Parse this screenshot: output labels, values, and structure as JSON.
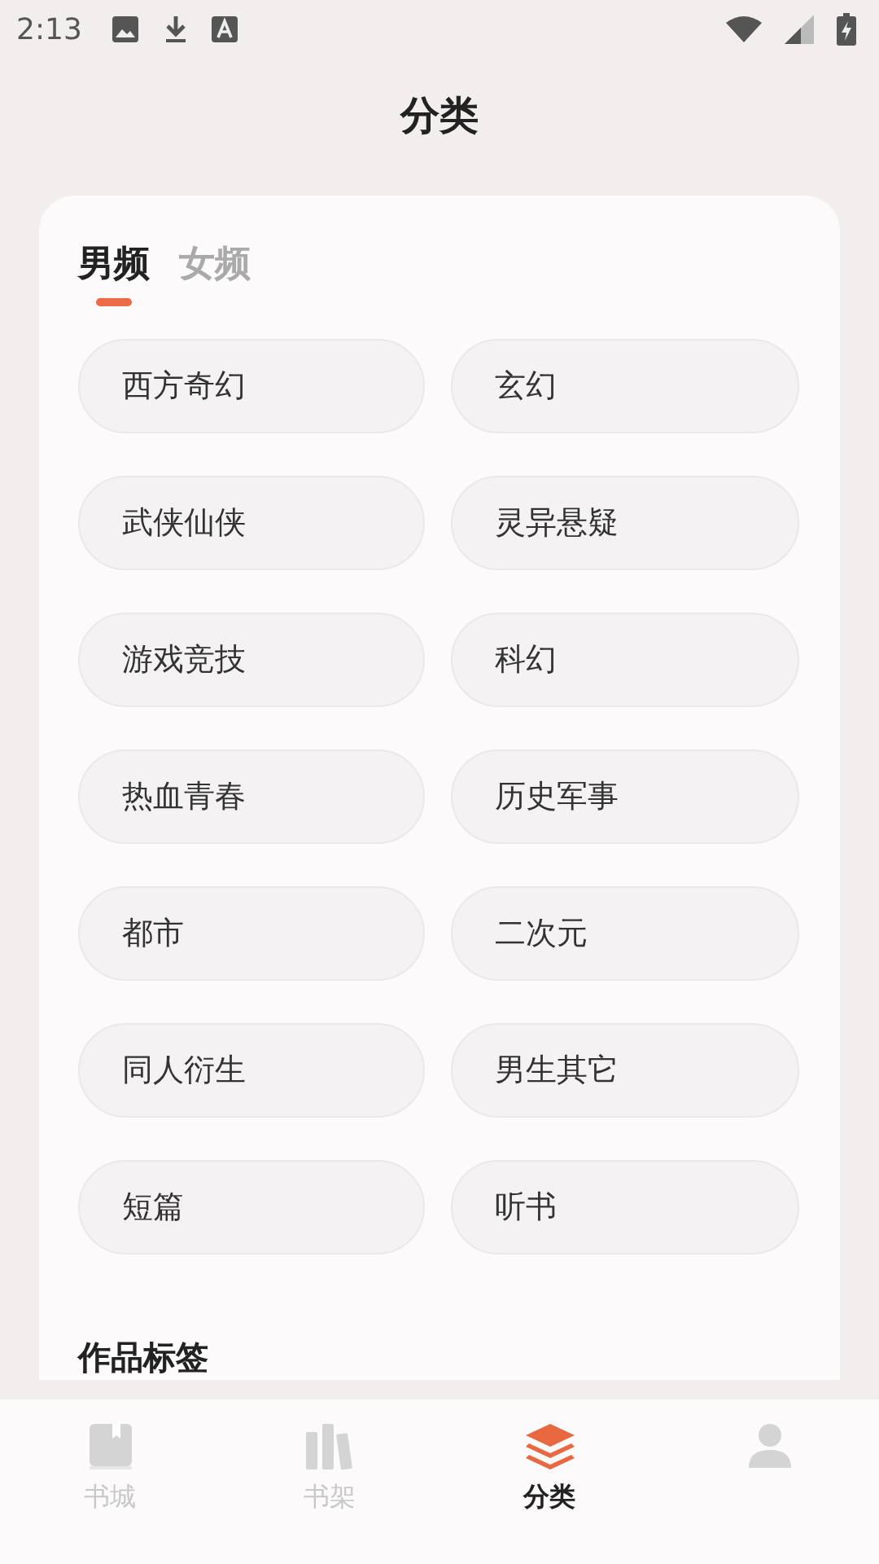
{
  "status_bar": {
    "time": "2:13"
  },
  "title": "分类",
  "tabs": [
    {
      "label": "男频",
      "selected": true
    },
    {
      "label": "女频",
      "selected": false
    }
  ],
  "categories": [
    "西方奇幻",
    "玄幻",
    "武侠仙侠",
    "灵异悬疑",
    "游戏竞技",
    "科幻",
    "热血青春",
    "历史军事",
    "都市",
    "二次元",
    "同人衍生",
    "男生其它",
    "短篇",
    "听书"
  ],
  "section_title": "作品标签",
  "nav": [
    {
      "kind": "book",
      "label": "书城",
      "selected": false
    },
    {
      "kind": "shelf",
      "label": "书架",
      "selected": false
    },
    {
      "kind": "layers",
      "label": "分类",
      "selected": true
    },
    {
      "kind": "person",
      "selected": false
    }
  ]
}
